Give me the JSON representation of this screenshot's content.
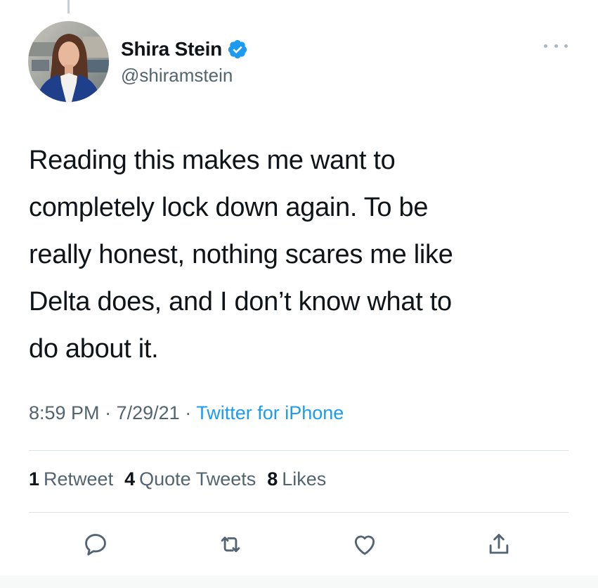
{
  "author": {
    "display_name": "Shira Stein",
    "handle": "@shiramstein",
    "verified": true,
    "avatar_icon": "profile-photo"
  },
  "tweet": {
    "text": "Reading this makes me want to\ncompletely lock down again. To be\nreally honest, nothing scares me like\nDelta does, and I don’t know what to\ndo about it."
  },
  "meta": {
    "time": "8:59 PM",
    "date": "7/29/21",
    "separator": "·",
    "source": "Twitter for iPhone"
  },
  "stats": {
    "retweets": {
      "count": "1",
      "label": "Retweet"
    },
    "quotes": {
      "count": "4",
      "label": "Quote Tweets"
    },
    "likes": {
      "count": "8",
      "label": "Likes"
    }
  },
  "actions": [
    {
      "name": "reply-icon"
    },
    {
      "name": "retweet-icon"
    },
    {
      "name": "like-icon"
    },
    {
      "name": "share-icon"
    }
  ],
  "colors": {
    "accent": "#1d9bf0",
    "text_primary": "#0f1419",
    "text_secondary": "#536471",
    "divider": "#dbe2e7"
  }
}
